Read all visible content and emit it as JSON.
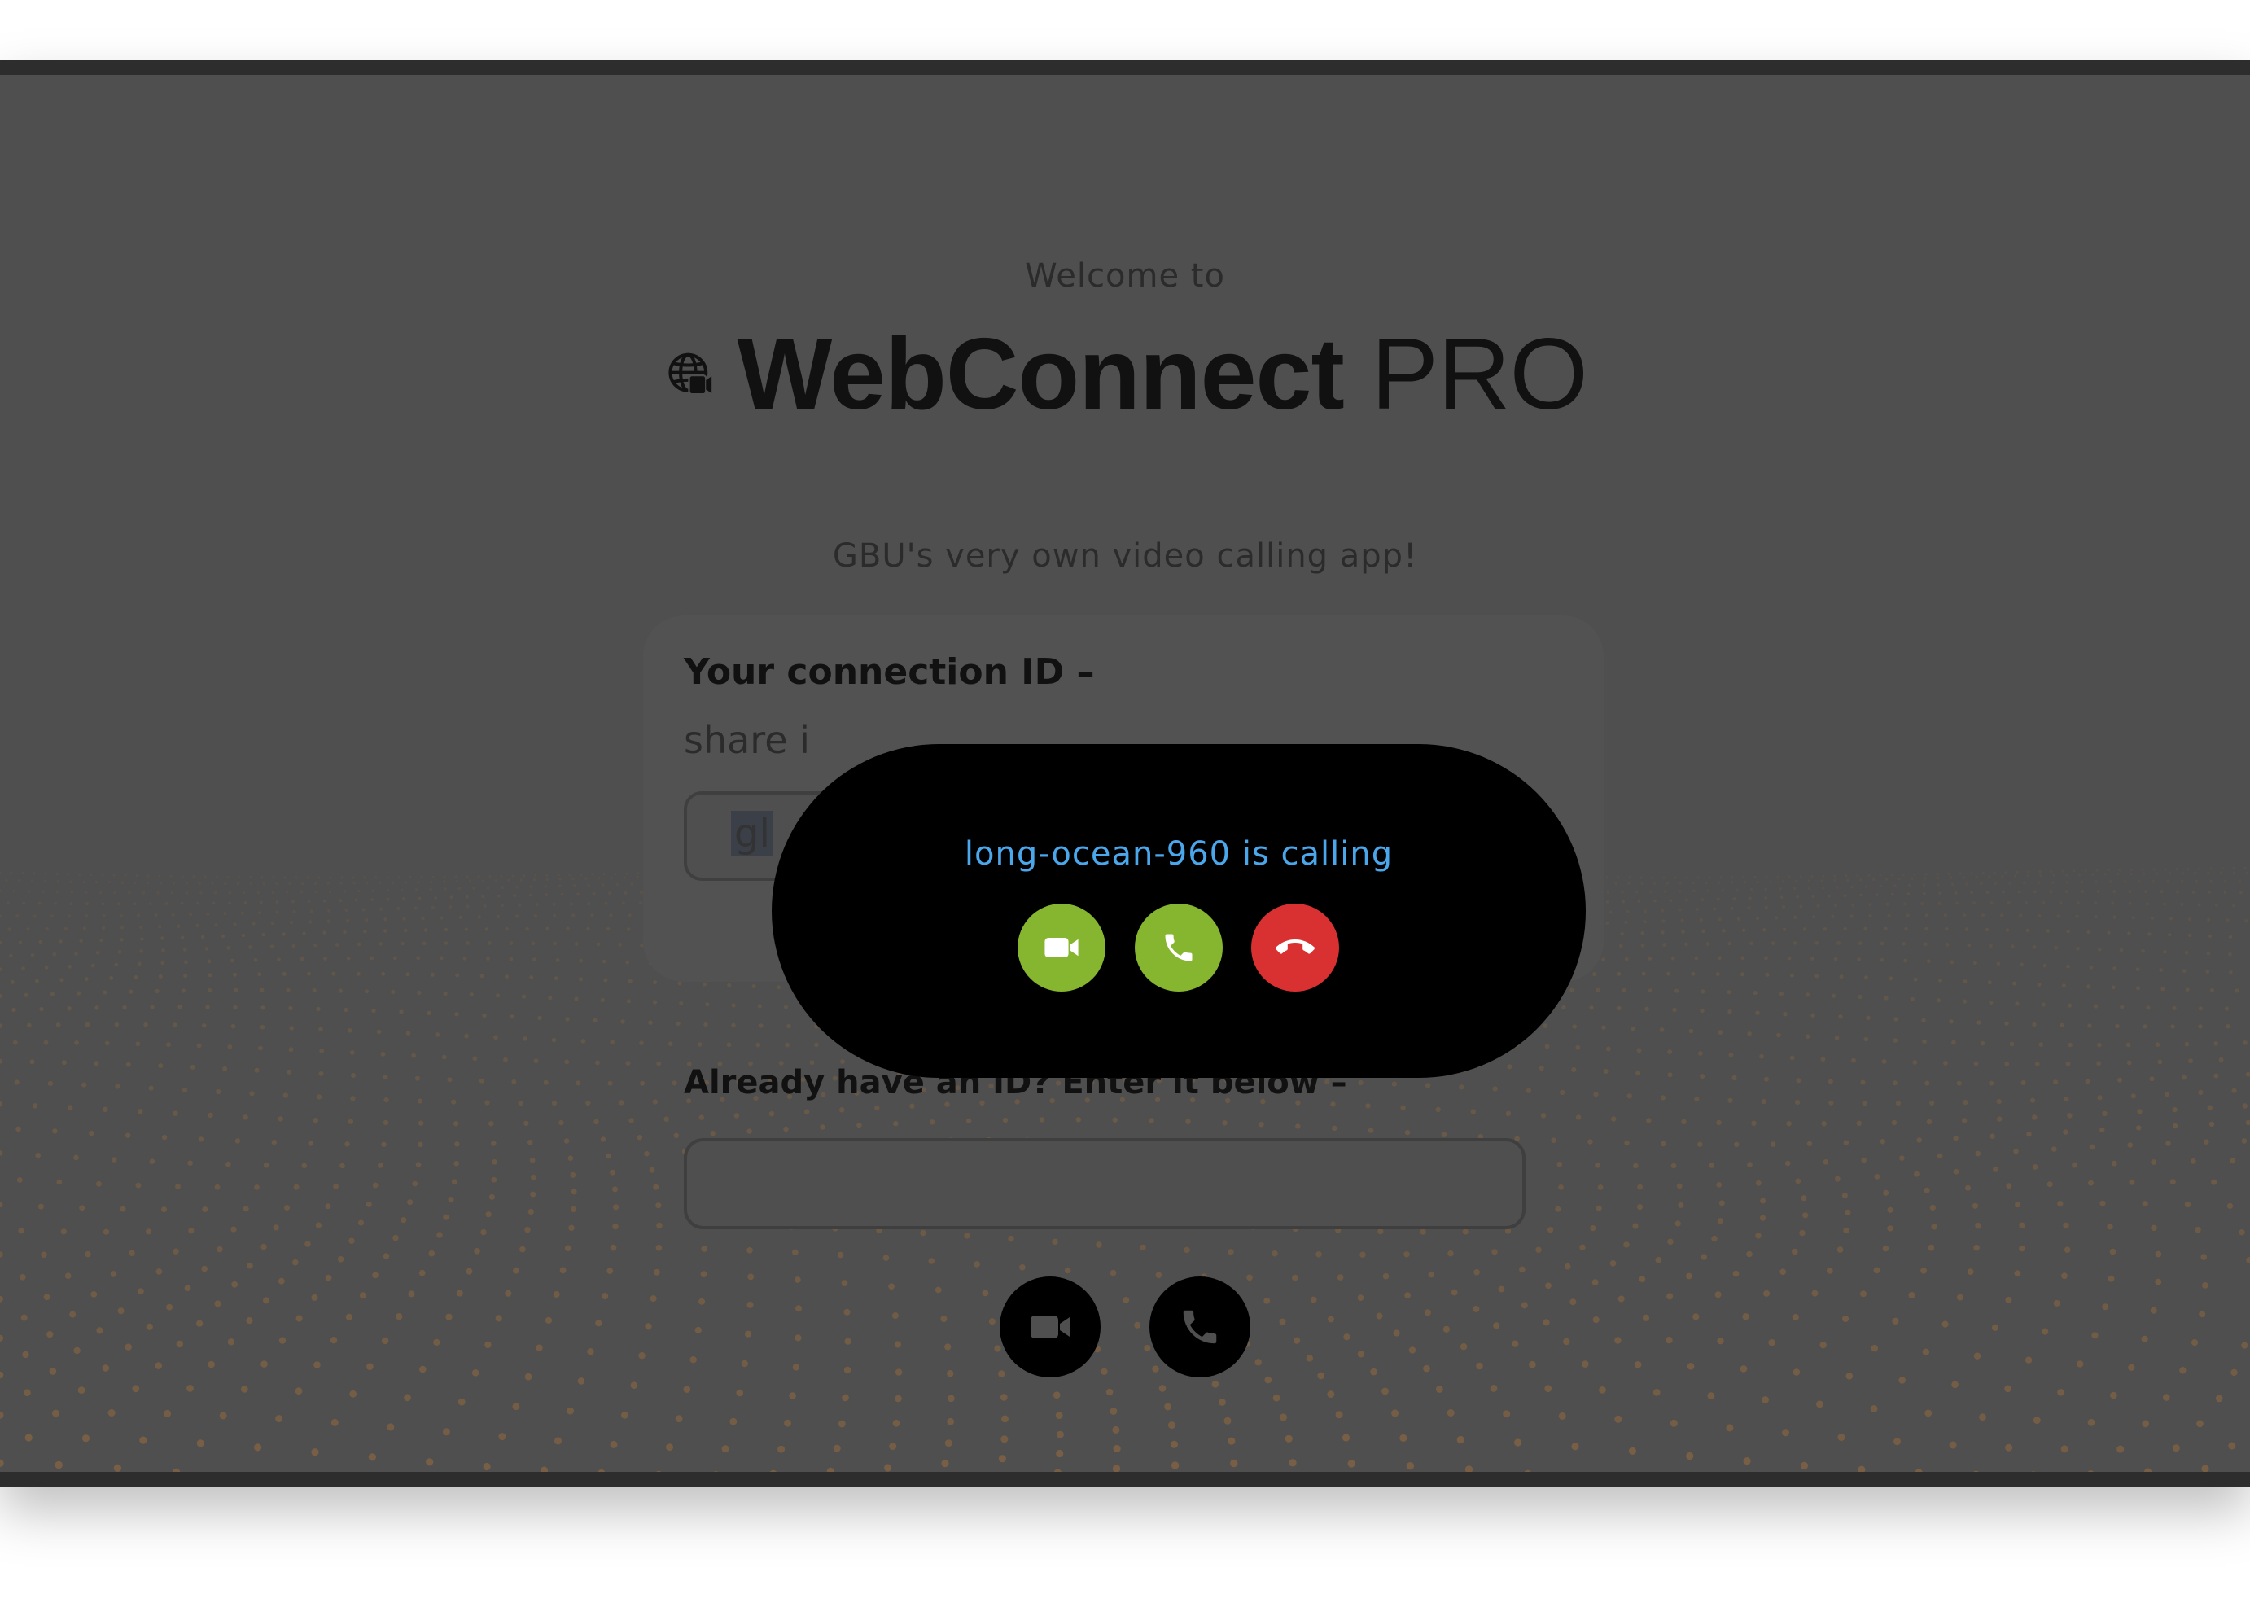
{
  "landing": {
    "welcome": "Welcome to",
    "brand_name": "WebConnect",
    "brand_suffix": "PRO",
    "tagline": "GBU's very own video calling app!"
  },
  "connection": {
    "label": "Your connection ID –",
    "sub": "share i",
    "id_visible": "gl"
  },
  "join": {
    "label": "Already have an ID? Enter it below –",
    "input_value": "",
    "video_icon": "video-camera-icon",
    "voice_icon": "phone-icon"
  },
  "incoming_call": {
    "caller_text": "long-ocean-960 is calling",
    "accept_video_icon": "video-camera-icon",
    "accept_voice_icon": "phone-icon",
    "decline_icon": "phone-hangup-icon"
  },
  "colors": {
    "overlay_background": "#4f4f4f",
    "popup_background": "#000000",
    "caller_text": "#4ba7ec",
    "accept": "#86b52f",
    "decline": "#d93131",
    "dots": "#8a6640"
  }
}
